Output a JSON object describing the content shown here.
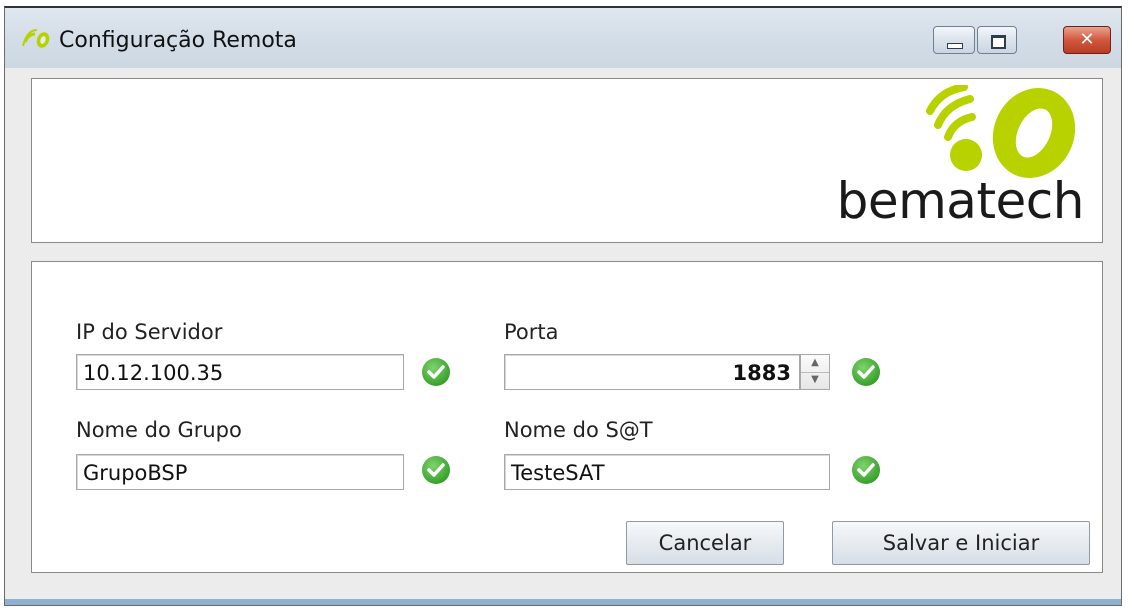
{
  "window": {
    "title": "Configuração Remota",
    "controls": [
      "minimize",
      "maximize",
      "close"
    ],
    "close_glyph": "✕"
  },
  "brand": {
    "name": "bematech",
    "mark_color": "#b8d200"
  },
  "form": {
    "ip": {
      "label": "IP do Servidor",
      "value": "10.12.100.35",
      "status": "valid"
    },
    "porta": {
      "label": "Porta",
      "value": "1883",
      "status": "valid"
    },
    "grupo": {
      "label": "Nome do Grupo",
      "value": "GrupoBSP",
      "status": "valid"
    },
    "sat": {
      "label": "Nome do S@T",
      "value": "TesteSAT",
      "status": "valid"
    }
  },
  "buttons": {
    "cancel": "Cancelar",
    "save": "Salvar e Iniciar"
  },
  "icons": {
    "valid": "check-circle-icon"
  },
  "colors": {
    "valid_green": "#3aa22d",
    "close_red": "#c8472f"
  }
}
